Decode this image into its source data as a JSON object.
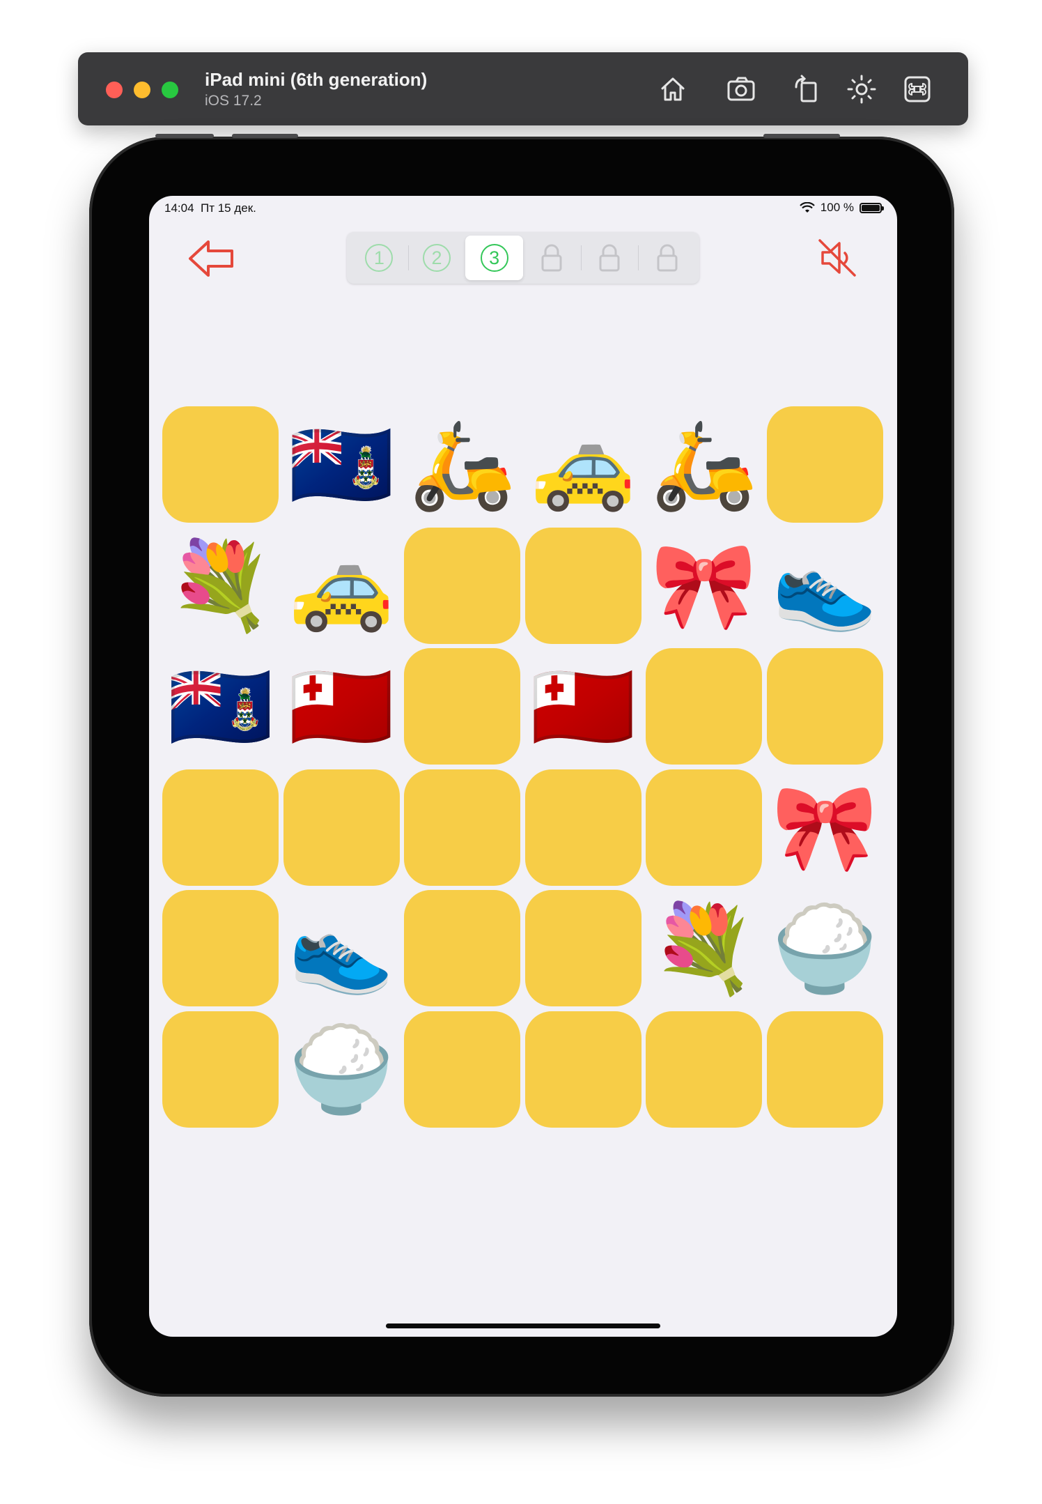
{
  "simulator": {
    "device_name": "iPad mini (6th generation)",
    "os_version": "iOS 17.2",
    "toolbar_icons": [
      "home-icon",
      "screenshot-icon",
      "rotate-icon",
      "appearance-icon",
      "command-icon"
    ]
  },
  "status_bar": {
    "time": "14:04",
    "date": "Пт 15 дек.",
    "battery": "100 %"
  },
  "app": {
    "back_icon": "arrow-left-icon",
    "sound_icon": "speaker-muted-icon",
    "accent_color": "#e5483b",
    "card_color": "#f7cd47",
    "levels": [
      {
        "label": "1",
        "state": "completed"
      },
      {
        "label": "2",
        "state": "completed"
      },
      {
        "label": "3",
        "state": "selected"
      },
      {
        "label": "",
        "state": "locked"
      },
      {
        "label": "",
        "state": "locked"
      },
      {
        "label": "",
        "state": "locked"
      }
    ],
    "board": [
      [
        "",
        "🇰🇾",
        "🛵",
        "🚕",
        "🛵",
        ""
      ],
      [
        "💐",
        "🚕",
        "",
        "",
        "🎀",
        "👟"
      ],
      [
        "🇰🇾",
        "🇹🇴",
        "",
        "🇹🇴",
        "",
        ""
      ],
      [
        "",
        "",
        "",
        "",
        "",
        "🎀"
      ],
      [
        "",
        "👟",
        "",
        "",
        "💐",
        "🍚"
      ],
      [
        "",
        "🍚",
        "",
        "",
        "",
        ""
      ]
    ]
  }
}
